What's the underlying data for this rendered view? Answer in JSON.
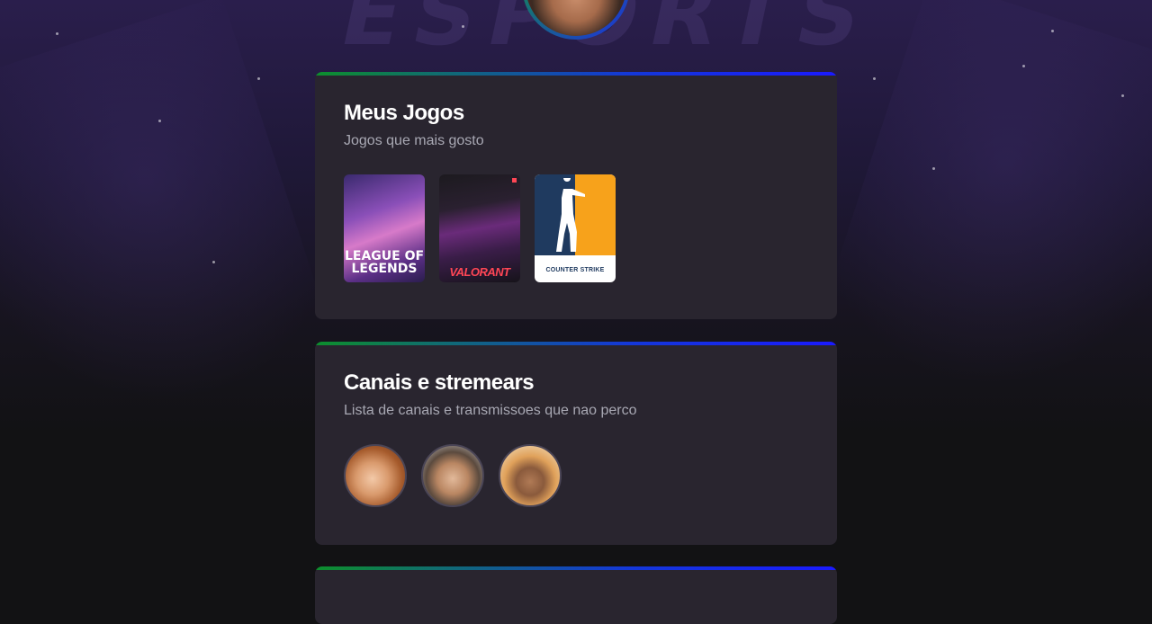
{
  "profile": {
    "avatar_alt": "avatar"
  },
  "games_section": {
    "title": "Meus Jogos",
    "subtitle": "Jogos que mais gosto",
    "games": [
      {
        "name": "League of Legends",
        "logo_text": "LEAGUE OF LEGENDS"
      },
      {
        "name": "Valorant",
        "logo_text": "VALORANT"
      },
      {
        "name": "Counter-Strike",
        "logo_text": "COUNTER STRIKE"
      }
    ]
  },
  "channels_section": {
    "title": "Canais e stremears",
    "subtitle": "Lista de canais e transmissoes que nao perco",
    "channels": [
      {
        "name": "channel-1"
      },
      {
        "name": "channel-2"
      },
      {
        "name": "channel-3"
      }
    ]
  },
  "colors": {
    "card_bg": "#29252f",
    "gradient_start": "#0d8f2c",
    "gradient_end": "#1a1aff",
    "text_muted": "#a8a8b3"
  }
}
